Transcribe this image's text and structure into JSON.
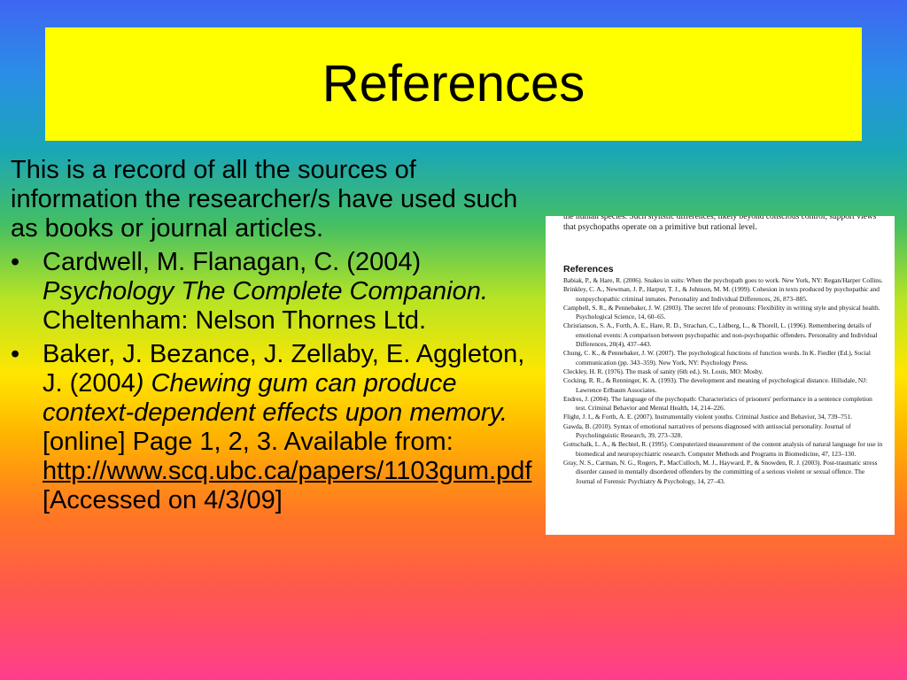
{
  "slide": {
    "title": "References",
    "intro": "This is a record of all the sources of information the researcher/s have used such as books or journal articles.",
    "bullets": [
      {
        "marker": "•",
        "text_a": "Cardwell, M. Flanagan, C. (2004) ",
        "italic": "Psychology The Complete Companion.",
        "text_b": " Cheltenham: Nelson Thornes Ltd."
      },
      {
        "marker": "•",
        "text_a": "Baker, J. Bezance, J. Zellaby, E. Aggleton, J. (2004",
        "italic": ") Chewing gum can produce context-dependent effects upon memory.",
        "text_b": " [online] Page 1, 2, 3.  Available from: ",
        "link": "http://www.scq.ubc.ca/papers/1103gum.pdf",
        "text_c": " [Accessed on 4/3/09]"
      }
    ]
  },
  "reference_image": {
    "top_text": "the human species. Such stylistic differences, likely beyond conscious control, support views that psychopaths operate on a primitive but rational level.",
    "heading": "References",
    "entries": [
      "Babiak, P., & Hare, R. (2006). Snakes in suits: When the psychopath goes to work. New York, NY: Regan/Harper Collins.",
      "Brinkley, C. A., Newman, J. P., Harpur, T. J., & Johnson, M. M. (1999). Cohesion in texts produced by psychopathic and nonpsychopathic criminal inmates. Personality and Individual Differences, 26, 873–885.",
      "Campbell, S. R., & Pennebaker, J. W. (2003). The secret life of pronouns: Flexibility in writing style and physical health. Psychological Science, 14, 60–65.",
      "Christianson, S. A., Forth, A. E., Hare, R. D., Strachan, C., Lidberg, L., & Thorell, L. (1996). Remembering details of emotional events: A comparison between psychopathic and non-psychopathic offenders. Personality and Individual Differences, 20(4), 437–443.",
      "Chung, C. K., & Pennebaker, J. W. (2007). The psychological functions of function words. In K. Fiedler (Ed.), Social communication (pp. 343–359). New York, NY: Psychology Press.",
      "Cleckley, H. R. (1976). The mask of sanity (6th ed.). St. Louis, MO: Mosby.",
      "Cocking, R. R., & Renninger, K. A. (1993). The development and meaning of psychological distance. Hillsdale, NJ: Lawrence Erlbaum Associates.",
      "Endres, J. (2004). The language of the psychopath: Characteristics of prisoners' performance in a sentence completion test. Criminal Behavior and Mental Health, 14, 214–226.",
      "Flight, J. I., & Forth, A. E. (2007). Instrumentally violent youths. Criminal Justice and Behavior, 34, 739–751.",
      "Gawda, B. (2010). Syntax of emotional narratives of persons diagnosed with antisocial personality. Journal of Psycholinguistic Research, 39, 273–328.",
      "Gottschalk, L. A., & Bechtel, R. (1995). Computerized measurement of the content analysis of natural language for use in biomedical and neuropsychiatric research. Computer Methods and Programs in Biomedicine, 47, 123–130.",
      "Gray, N. S., Carman, N. G., Rogers, P., MacCulloch, M. J., Hayward, P., & Snowden, R. J. (2003). Post-traumatic stress disorder caused in mentally disordered offenders by the committing of a serious violent or sexual offence. The Journal of Forensic Psychiatry & Psychology, 14, 27–43."
    ]
  }
}
